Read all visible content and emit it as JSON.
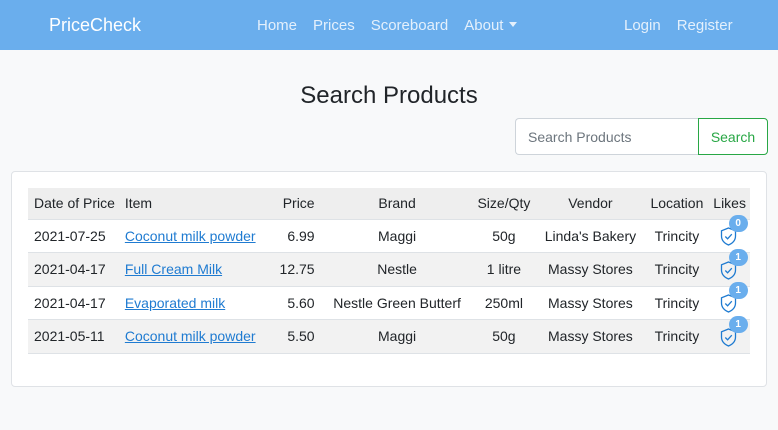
{
  "navbar": {
    "brand": "PriceCheck",
    "links_left": [
      "Home",
      "Prices",
      "Scoreboard",
      "About"
    ],
    "links_right": [
      "Login",
      "Register"
    ]
  },
  "page": {
    "title": "Search Products"
  },
  "search": {
    "placeholder": "Search Products",
    "button_label": "Search"
  },
  "table": {
    "headers": {
      "date": "Date of Price",
      "item": "Item",
      "price": "Price",
      "brand": "Brand",
      "size": "Size/Qty",
      "vendor": "Vendor",
      "location": "Location",
      "likes": "Likes"
    },
    "rows": [
      {
        "date": "2021-07-25",
        "item": "Coconut milk powder",
        "price": "6.99",
        "brand": "Maggi",
        "size": "50g",
        "vendor": "Linda's Bakery",
        "location": "Trincity",
        "likes": "0"
      },
      {
        "date": "2021-04-17",
        "item": "Full Cream Milk",
        "price": "12.75",
        "brand": "Nestle",
        "size": "1 litre",
        "vendor": "Massy Stores",
        "location": "Trincity",
        "likes": "1"
      },
      {
        "date": "2021-04-17",
        "item": "Evaporated milk",
        "price": "5.60",
        "brand": "Nestle Green Butterf",
        "size": "250ml",
        "vendor": "Massy Stores",
        "location": "Trincity",
        "likes": "1"
      },
      {
        "date": "2021-05-11",
        "item": "Coconut milk powder",
        "price": "5.50",
        "brand": "Maggi",
        "size": "50g",
        "vendor": "Massy Stores",
        "location": "Trincity",
        "likes": "1"
      }
    ]
  },
  "colors": {
    "navbar": "#6aaeed",
    "link": "#1f7bd1",
    "search_button": "#28a745",
    "badge": "#6aaeed"
  },
  "icons": {
    "like": "shield-check-icon",
    "dropdown": "caret-down-icon"
  }
}
